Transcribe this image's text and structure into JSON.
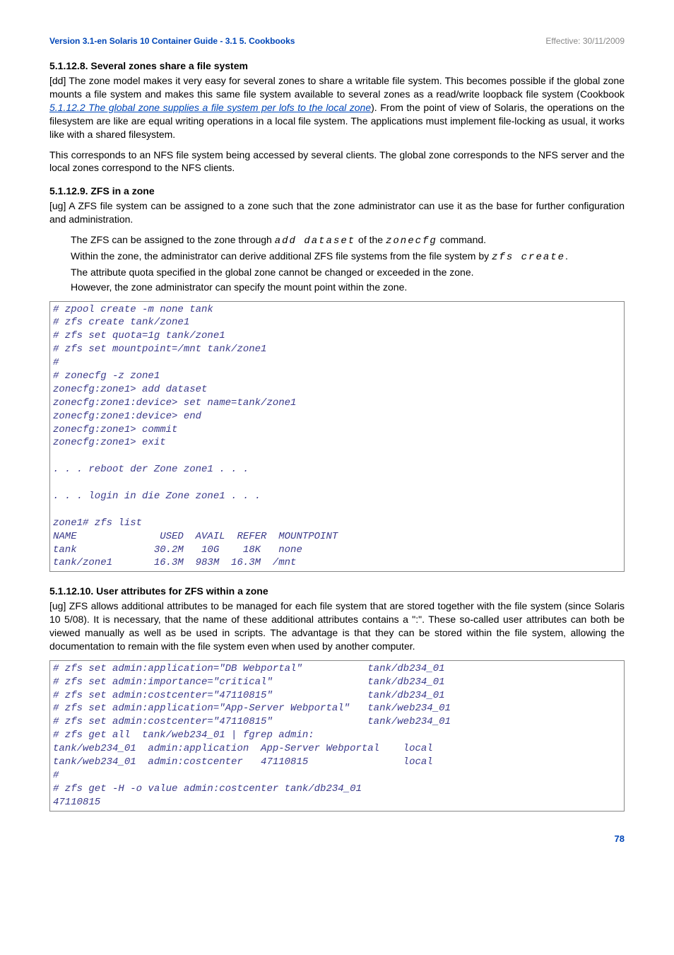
{
  "header": {
    "version": "Version 3.1-en",
    "trail": " Solaris 10 Container Guide - 3.1  5. Cookbooks",
    "effective": "Effective: 30/11/2009"
  },
  "sec1": {
    "title": "5.1.12.8. Several zones share a file system",
    "p1a": "[dd] The zone model makes it very easy for several zones to share a writable file system. This becomes possible if the global zone mounts a file system and makes this same file system available to several zones as a read/write loopback file system (Cookbook ",
    "link1": "5.1.12.2 The global zone supplies a file system per lofs to the local zone",
    "p1b": "). From the point of view of Solaris, the operations on the filesystem are like are equal writing operations in a local file system. The applications must implement file-locking as usual, it works like with a shared filesystem.",
    "p2": "This corresponds to an NFS file system being accessed by several clients. The global zone corresponds to the NFS server and the local zones correspond to the NFS clients."
  },
  "sec2": {
    "title": "5.1.12.9. ZFS in a zone",
    "p1": "[ug] A ZFS file system can be assigned to a zone such that the zone administrator can use it as the base for further configuration and administration.",
    "b1a": "The ZFS can be assigned to the zone through ",
    "b1cmd1": "add dataset",
    "b1mid": " of the ",
    "b1cmd2": "zonecfg",
    "b1b": " command.",
    "b2a": "Within the zone, the administrator can derive additional ZFS file systems from the file system by ",
    "b2cmd": "zfs create",
    "b2b": ".",
    "b3": "The attribute quota specified in the global zone cannot be changed or exceeded in the zone.",
    "b4": "However, the zone administrator can specify the mount point within the zone.",
    "code": "# zpool create -m none tank\n# zfs create tank/zone1\n# zfs set quota=1g tank/zone1\n# zfs set mountpoint=/mnt tank/zone1\n#\n# zonecfg -z zone1\nzonecfg:zone1> add dataset\nzonecfg:zone1:device> set name=tank/zone1\nzonecfg:zone1:device> end\nzonecfg:zone1> commit\nzonecfg:zone1> exit\n\n. . . reboot der Zone zone1 . . .\n\n. . . login in die Zone zone1 . . .\n\nzone1# zfs list\nNAME              USED  AVAIL  REFER  MOUNTPOINT\ntank             30.2M   10G    18K   none\ntank/zone1       16.3M  983M  16.3M  /mnt"
  },
  "sec3": {
    "title": "5.1.12.10. User attributes for ZFS within a zone",
    "p1": "[ug] ZFS allows additional attributes to be managed for each file system that are stored together with the file system (since Solaris 10 5/08). It is necessary,  that the name of these additional attributes contains a \":\".  These so-called user attributes can both be viewed manually as well as be used in scripts. The advantage is that they can be stored within the file system, allowing the documentation to remain with the file system even when used by another computer.",
    "code": "# zfs set admin:application=\"DB Webportal\"           tank/db234_01\n# zfs set admin:importance=\"critical\"                tank/db234_01\n# zfs set admin:costcenter=\"47110815\"                tank/db234_01\n# zfs set admin:application=\"App-Server Webportal\"   tank/web234_01\n# zfs set admin:costcenter=\"47110815\"                tank/web234_01\n# zfs get all  tank/web234_01 | fgrep admin:\ntank/web234_01  admin:application  App-Server Webportal    local\ntank/web234_01  admin:costcenter   47110815                local\n#\n# zfs get -H -o value admin:costcenter tank/db234_01\n47110815"
  },
  "pagenum": "78"
}
